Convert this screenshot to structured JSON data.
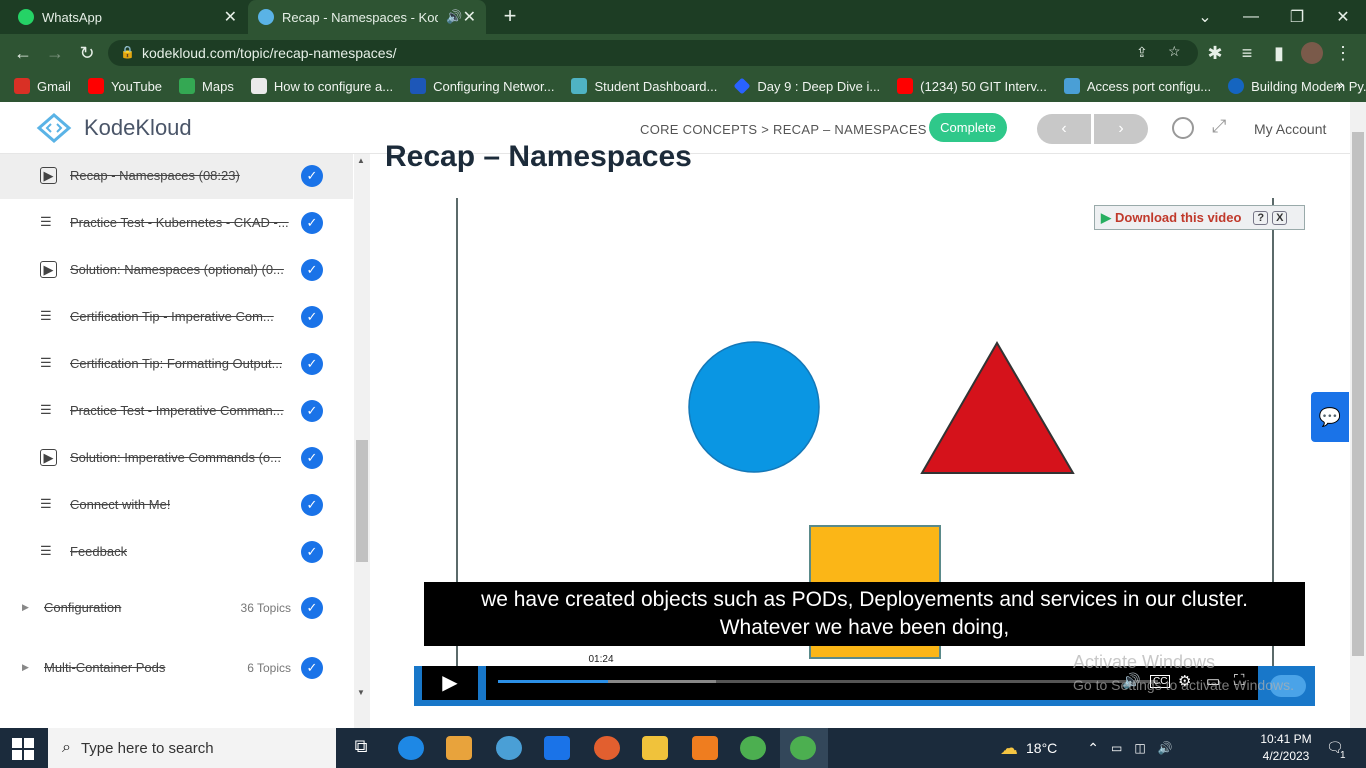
{
  "browser": {
    "tabs": [
      {
        "title": "WhatsApp",
        "favicon": "whatsapp-icon",
        "color": "#25d366"
      },
      {
        "title": "Recap - Namespaces - Kodel",
        "favicon": "kodekloud-icon",
        "color": "#5ab3e6"
      }
    ],
    "url": "kodekloud.com/topic/recap-namespaces/",
    "bookmarks": [
      {
        "label": "Gmail",
        "color": "#d93025"
      },
      {
        "label": "YouTube",
        "color": "#ff0000"
      },
      {
        "label": "Maps",
        "color": "#34a853"
      },
      {
        "label": "How to configure a...",
        "color": "#eaeaea"
      },
      {
        "label": "Configuring Networ...",
        "color": "#1d57b8"
      },
      {
        "label": "Student Dashboard...",
        "color": "#4fb3c4"
      },
      {
        "label": "Day 9 : Deep Dive i...",
        "color": "#2962ff"
      },
      {
        "label": "(1234) 50 GIT Interv...",
        "color": "#ff0000"
      },
      {
        "label": "Access port configu...",
        "color": "#4a9fd6"
      },
      {
        "label": "Building Modern Py...",
        "color": "#1565c0"
      }
    ]
  },
  "site": {
    "brand": "KodeKloud",
    "breadcrumb": "CORE CONCEPTS > RECAP – NAMESPACES",
    "complete_label": "Complete",
    "prev_label": "‹",
    "next_label": "›",
    "account_label": "My Account"
  },
  "sidebar": {
    "lessons": [
      {
        "label": "Recap - Namespaces (08:23)",
        "type": "video"
      },
      {
        "label": "Practice Test - Kubernetes - CKAD -...",
        "type": "text"
      },
      {
        "label": "Solution: Namespaces (optional) (0...",
        "type": "video"
      },
      {
        "label": "Certification Tip - Imperative Com...",
        "type": "text"
      },
      {
        "label": "Certification Tip: Formatting Output...",
        "type": "text"
      },
      {
        "label": "Practice Test - Imperative Comman...",
        "type": "text"
      },
      {
        "label": "Solution: Imperative Commands (o...",
        "type": "video"
      },
      {
        "label": "Connect with Me!",
        "type": "text"
      },
      {
        "label": "Feedback",
        "type": "text"
      }
    ],
    "sections": [
      {
        "label": "Configuration",
        "count": "36 Topics"
      },
      {
        "label": "Multi-Container Pods",
        "count": "6 Topics"
      }
    ]
  },
  "main": {
    "title": "Recap – Namespaces",
    "download_label": "Download this video",
    "caption_line1": "we have created objects such as PODs, Deployements and services in our cluster.",
    "caption_line2": "Whatever we have been doing,",
    "timestamp": "01:24",
    "progress_fraction": 0.167,
    "buffer_fraction": 0.33,
    "watermark_line1": "Activate Windows",
    "watermark_line2": "Go to Settings to activate Windows."
  },
  "taskbar": {
    "search_placeholder": "Type here to search",
    "temperature": "18°C",
    "time": "10:41 PM",
    "date": "4/2/2023",
    "notifications": "1"
  }
}
